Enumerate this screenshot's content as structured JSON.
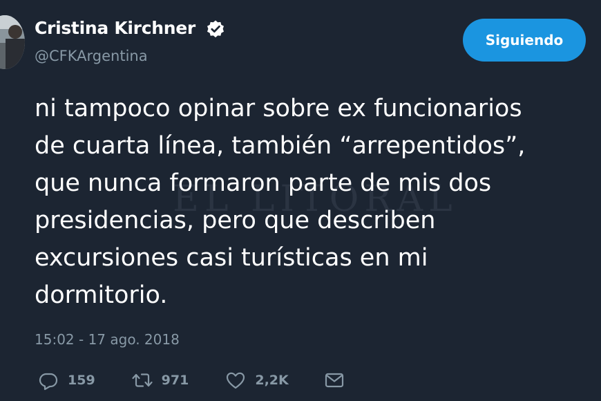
{
  "user": {
    "display_name": "Cristina Kirchner",
    "handle": "@CFKArgentina",
    "verified": true
  },
  "follow_button": {
    "label": "Siguiendo"
  },
  "tweet": {
    "text": "ni tampoco opinar sobre ex funcionarios\nde cuarta línea, también “arrepentidos”,\nque nunca formaron parte de mis dos\npresidencias, pero que describen\nexcursiones casi turísticas en mi\ndormitorio.",
    "timestamp": "15:02 - 17 ago. 2018"
  },
  "watermark": "EL LITORAL",
  "actions": {
    "replies": "159",
    "retweets": "971",
    "likes": "2,2K"
  },
  "icons": {
    "verified": "verified-badge-icon",
    "reply": "reply-bubble-icon",
    "retweet": "retweet-icon",
    "like": "heart-icon",
    "message": "envelope-icon"
  },
  "colors": {
    "background": "#1c2532",
    "text": "#ffffff",
    "muted": "#8899a6",
    "accent": "#1b95e0"
  }
}
